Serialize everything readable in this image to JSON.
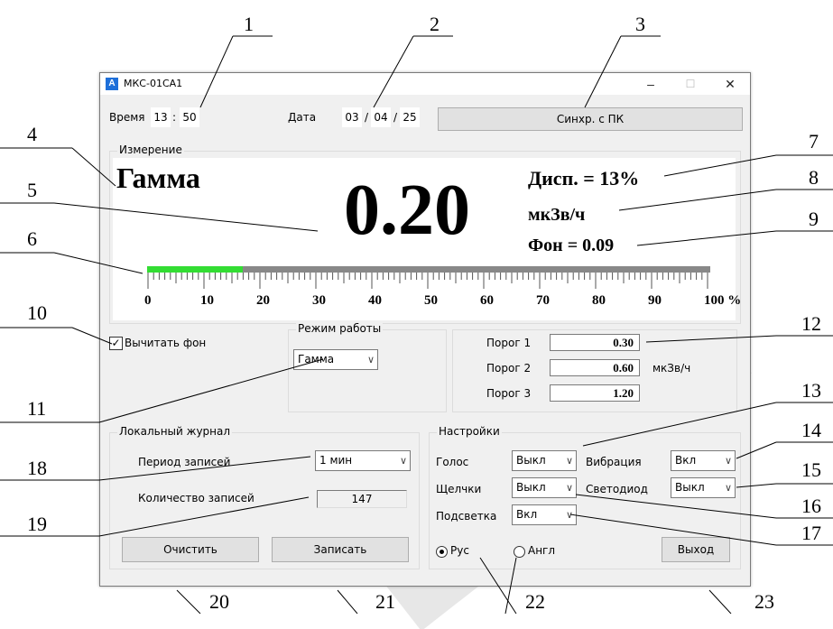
{
  "window": {
    "title": "МКС-01СА1",
    "icon_label": "А",
    "minimize": "–",
    "maximize": "☐",
    "close": "✕"
  },
  "top_row": {
    "time_label": "Время",
    "time_h": "13",
    "time_sep": ":",
    "time_m": "50",
    "date_label": "Дата",
    "date_d": "03",
    "date_m": "04",
    "date_y": "25",
    "date_sep": "/",
    "sync_button": "Синхр. с ПК"
  },
  "measurement": {
    "group_title": "Измерение",
    "mode": "Гамма",
    "value": "0.20",
    "disp": "Дисп. = 13%",
    "unit": "мкЗв/ч",
    "background": "Фон = 0.09",
    "bar_fill_percent": 17,
    "scale_labels": [
      "0",
      "10",
      "20",
      "30",
      "40",
      "50",
      "60",
      "70",
      "80",
      "90",
      "100 %"
    ],
    "bar_color": "#33dd33"
  },
  "subtract_bg": {
    "label": "Вычитать фон",
    "checked": true
  },
  "work_mode": {
    "group_title": "Режим работы",
    "selected": "Гамма"
  },
  "thresholds": {
    "items": [
      {
        "label": "Порог 1",
        "value": "0.30"
      },
      {
        "label": "Порог 2",
        "value": "0.60"
      },
      {
        "label": "Порог 3",
        "value": "1.20"
      }
    ],
    "unit": "мкЗв/ч"
  },
  "journal": {
    "group_title": "Локальный журнал",
    "period_label": "Период записей",
    "period_value": "1 мин",
    "count_label": "Количество записей",
    "count_value": "147",
    "clear_button": "Очистить",
    "write_button": "Записать"
  },
  "settings": {
    "group_title": "Настройки",
    "voice_label": "Голос",
    "voice_value": "Выкл",
    "clicks_label": "Щелчки",
    "clicks_value": "Выкл",
    "backlight_label": "Подсветка",
    "backlight_value": "Вкл",
    "vibration_label": "Вибрация",
    "vibration_value": "Вкл",
    "led_label": "Светодиод",
    "led_value": "Выкл",
    "lang_ru": "Рус",
    "lang_en": "Англ",
    "exit_button": "Выход"
  },
  "callouts": [
    "1",
    "2",
    "3",
    "4",
    "5",
    "6",
    "7",
    "8",
    "9",
    "10",
    "11",
    "12",
    "13",
    "14",
    "15",
    "16",
    "17",
    "18",
    "19",
    "20",
    "21",
    "22",
    "23"
  ]
}
